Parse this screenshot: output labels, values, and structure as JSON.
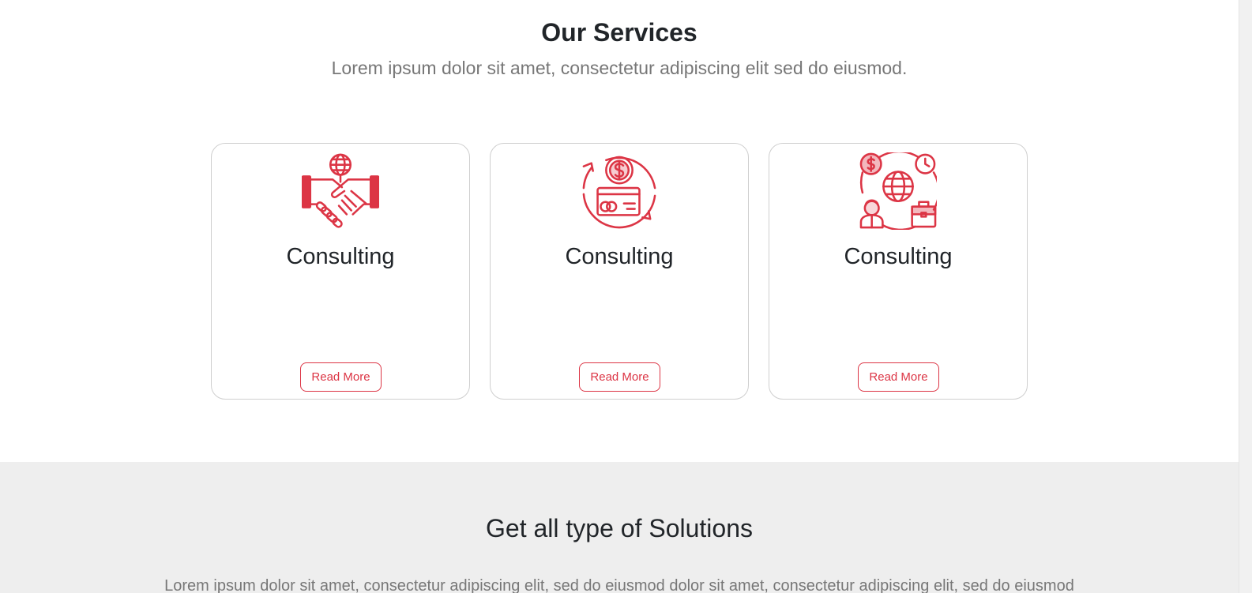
{
  "services": {
    "title": "Our Services",
    "subtitle": "Lorem ipsum dolor sit amet, consectetur adipiscing elit sed do eiusmod.",
    "cards": [
      {
        "icon": "handshake-globe-icon",
        "title": "Consulting",
        "button_label": "Read More"
      },
      {
        "icon": "payment-cycle-icon",
        "title": "Consulting",
        "button_label": "Read More"
      },
      {
        "icon": "global-business-icon",
        "title": "Consulting",
        "button_label": "Read More"
      }
    ]
  },
  "solutions": {
    "title": "Get all type of Solutions",
    "text": "Lorem ipsum dolor sit amet, consectetur adipiscing elit, sed do eiusmod dolor sit amet, consectetur adipiscing elit, sed do eiusmod"
  },
  "colors": {
    "accent": "#dc3545",
    "heading": "#212529",
    "muted_text": "#777777",
    "section_bg": "#eeeeee",
    "card_border": "#cfcfcf"
  }
}
